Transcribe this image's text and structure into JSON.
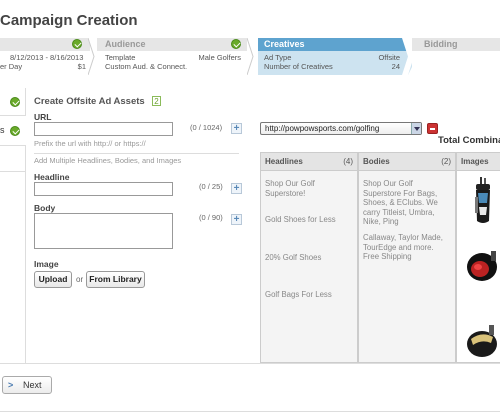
{
  "page_title": "Campaign Creation",
  "steps": {
    "dates": {
      "range": "8/12/2013 - 8/16/2013",
      "per_day_label": "er Day",
      "per_day_value": "$1"
    },
    "audience": {
      "title": "Audience",
      "template_label": "Template",
      "template_value": "Male Golfers",
      "desc": "Custom Aud. & Connect."
    },
    "creatives": {
      "title": "Creatives",
      "ad_type_label": "Ad Type",
      "ad_type_value": "Offsite",
      "num_label": "Number of Creatives",
      "num_value": "24"
    },
    "bidding": {
      "title": "Bidding"
    }
  },
  "sidebar": {
    "item2_label": "s"
  },
  "form": {
    "section_title": "Create Offsite Ad Assets",
    "section_badge": "2",
    "url_label": "URL",
    "url_count": "(0 / 1024)",
    "url_hint": "Prefix the url with http:// or https://",
    "multi_hint": "Add Multiple Headlines, Bodies, and Images",
    "headline_label": "Headline",
    "headline_count": "(0 / 25)",
    "body_label": "Body",
    "body_count": "(0 / 90)",
    "image_label": "Image",
    "upload_label": "Upload",
    "or_label": "or",
    "library_label": "From Library"
  },
  "assets": {
    "url_selected": "http://powpowsports.com/golfing",
    "total_label": "Total Combina",
    "headlines_title": "Headlines",
    "headlines_count": "(4)",
    "bodies_title": "Bodies",
    "bodies_count": "(2)",
    "images_title": "Images",
    "headlines": [
      "Shop Our Golf Superstore!",
      "Gold Shoes for Less",
      "20% Golf Shoes",
      "Golf Bags For Less"
    ],
    "bodies": [
      "Shop Our Golf Superstore For Bags, Shoes, & EClubs. We carry Titleist, Umbra, Nike, Ping",
      "Callaway, Taylor Made, TourEdge and more. Free Shipping"
    ]
  },
  "footer": {
    "next_label": "Next"
  }
}
